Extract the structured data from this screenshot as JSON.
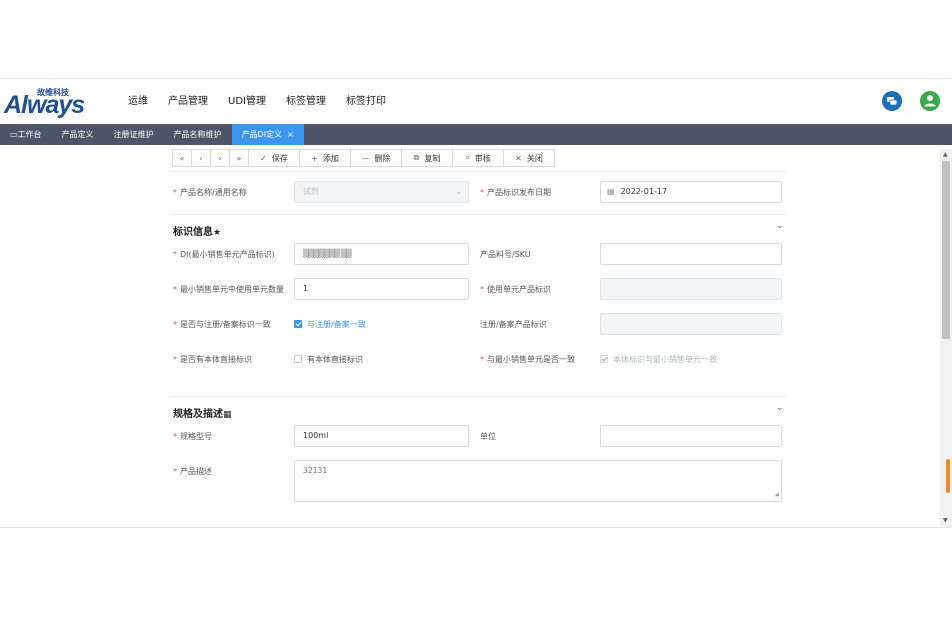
{
  "brand": {
    "logo_word": "Always",
    "logo_cn": "故维科技"
  },
  "topnav": [
    "运维",
    "产品管理",
    "UDI管理",
    "标签管理",
    "标签打印"
  ],
  "tabs": [
    {
      "label": "工作台"
    },
    {
      "label": "产品定义"
    },
    {
      "label": "注册证维护"
    },
    {
      "label": "产品名称维护"
    },
    {
      "label": "产品DI定义",
      "close": "×",
      "active": true
    }
  ],
  "toolbar": {
    "nav": [
      "«",
      "‹",
      "›",
      "»"
    ],
    "buttons": [
      {
        "icon": "✓",
        "label": "保存"
      },
      {
        "icon": "+",
        "label": "添加"
      },
      {
        "icon": "—",
        "label": "删除"
      },
      {
        "icon": "⧉",
        "label": "复制"
      },
      {
        "icon": "⌕",
        "label": "审核"
      },
      {
        "icon": "✕",
        "label": "关闭"
      }
    ]
  },
  "form_top": {
    "product_name_label": "产品名称/通用名称",
    "product_name_value": "试剂",
    "release_date_label": "产品标识发布日期",
    "release_date_value": "2022-01-17"
  },
  "section_id": {
    "title": "标识信息",
    "title_mark": "★",
    "di_label": "DI(最小销售单元产品标识)",
    "di_value": "▒▒▒▒▒▒▒ ▒▒",
    "sku_label": "产品料号/SKU",
    "sku_value": "",
    "min_qty_label": "最小销售单元中使用单元数量",
    "min_qty_value": "1",
    "use_unit_label": "使用单元产品标识",
    "use_unit_value": "",
    "reg_consistent_label": "是否与注册/备案标识一致",
    "reg_consistent_check": "与注册/备案一致",
    "reg_id_label": "注册/备案产品标识",
    "reg_id_value": "",
    "direct_mark_label": "是否有本体直接标识",
    "direct_mark_check": "有本体直接标识",
    "same_as_min_label": "与最小销售单元是否一致",
    "same_as_min_check": "本体标识与最小销售单元一致"
  },
  "section_spec": {
    "title": "规格及描述",
    "title_mark": "▦",
    "model_label": "规格型号",
    "model_value": "100ml",
    "unit_label": "单位",
    "unit_value": "",
    "desc_label": "产品描述",
    "desc_value": "32131"
  },
  "colors": {
    "accent": "#3a96f0",
    "tabbar": "#4e5568",
    "brand": "#1d4f91",
    "required": "#f04b4b"
  }
}
